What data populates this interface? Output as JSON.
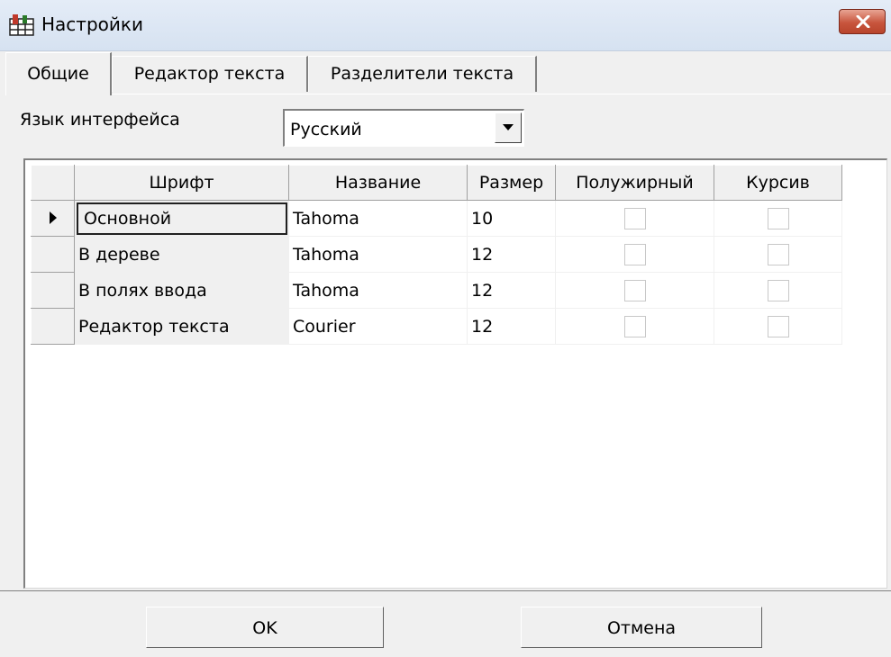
{
  "window": {
    "title": "Настройки"
  },
  "tabs": [
    {
      "label": "Общие",
      "active": true
    },
    {
      "label": "Редактор текста",
      "active": false
    },
    {
      "label": "Разделители текста",
      "active": false
    }
  ],
  "language": {
    "label": "Язык интерфейса",
    "value": "Русский"
  },
  "grid": {
    "columns": [
      "Шрифт",
      "Название",
      "Размер",
      "Полужирный",
      "Курсив"
    ],
    "rows": [
      {
        "font": "Основной",
        "name": "Tahoma",
        "size": "10",
        "bold": false,
        "italic": false,
        "current": true
      },
      {
        "font": "В дереве",
        "name": "Tahoma",
        "size": "12",
        "bold": false,
        "italic": false,
        "current": false
      },
      {
        "font": "В полях ввода",
        "name": "Tahoma",
        "size": "12",
        "bold": false,
        "italic": false,
        "current": false
      },
      {
        "font": "Редактор текста",
        "name": "Courier",
        "size": "12",
        "bold": false,
        "italic": false,
        "current": false
      }
    ]
  },
  "buttons": {
    "ok": "OK",
    "cancel": "Отмена"
  },
  "icons": {
    "app": "settings-grid-icon",
    "close": "close-icon",
    "dropdown": "chevron-down-icon",
    "row_pointer": "row-pointer-icon"
  },
  "colors": {
    "close_button": "#c8553d",
    "title_bar": "#dde7f4"
  }
}
